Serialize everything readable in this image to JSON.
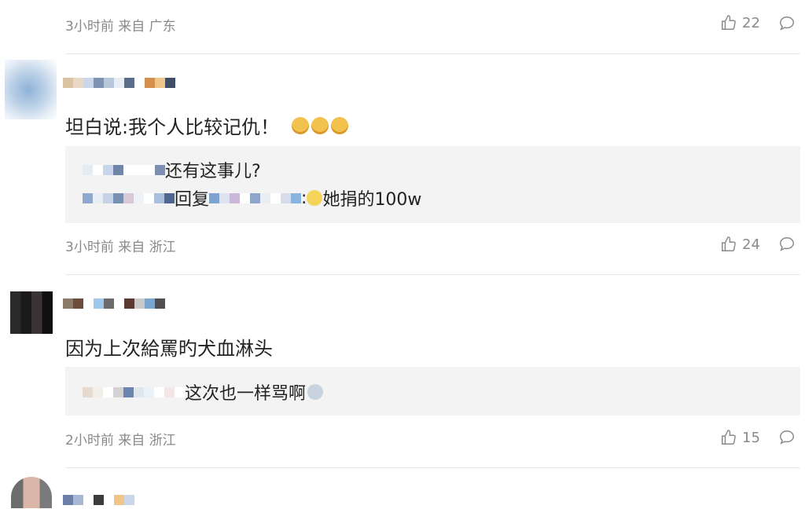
{
  "comments": [
    {
      "meta": "3小时前 来自 广东",
      "likes": "22"
    },
    {
      "content": "坦白说:我个人比较记仇！",
      "content_emojis": [
        "cat-face-emoji",
        "cat-face-emoji",
        "cat-face-emoji"
      ],
      "replies": [
        {
          "text": "还有这事儿?"
        },
        {
          "prefix": "回复",
          "sep": ":",
          "text": "她捐的100w"
        }
      ],
      "meta": "3小时前 来自 浙江",
      "likes": "24"
    },
    {
      "content": "因为上次給罵旳犬血淋头",
      "replies": [
        {
          "text": "这次也一样骂啊"
        }
      ],
      "meta": "2小时前 来自 浙江",
      "likes": "15"
    }
  ],
  "colors": {
    "meta_gray": "#8a8a8a",
    "quote_bg": "#f3f3f3",
    "divider": "#e8e8e8"
  }
}
